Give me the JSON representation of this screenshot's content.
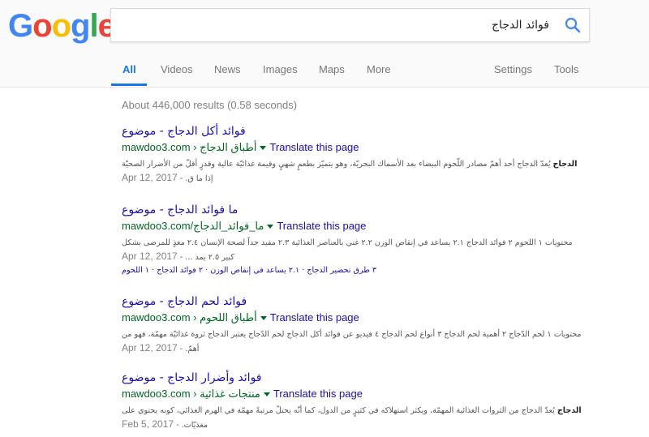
{
  "logo": {
    "letters": [
      "G",
      "o",
      "o",
      "g",
      "l",
      "e"
    ],
    "colors": [
      "#4285F4",
      "#EA4335",
      "#FBBC05",
      "#4285F4",
      "#34A853",
      "#EA4335"
    ]
  },
  "search": {
    "value": "فوائد الدجاج"
  },
  "tabs": [
    {
      "label": "All",
      "active": true
    },
    {
      "label": "Videos"
    },
    {
      "label": "News"
    },
    {
      "label": "Images"
    },
    {
      "label": "Maps"
    },
    {
      "label": "More"
    }
  ],
  "tools": {
    "settings": "Settings",
    "tools": "Tools"
  },
  "stats": "About 446,000 results (0.58 seconds)",
  "translate_label": "Translate this page",
  "results": [
    {
      "title": "فوائد أكل الدجاج - موضوع",
      "url": "mawdoo3.com",
      "path": " › أطباق الدجاج",
      "date": "Apr 12, 2017",
      "snippet_bold": "الدجاج",
      "snippet": " يُعدّ الدجاج أحد أهمّ مصادر اللّحوم البيضاء بعد الأسماك البحريّة، وهو يتميّز بطعمٍ شهيٍ وقيمة غذائيّة عالية وقدرٍ أقلّ من الأضرار الصحيّة إذا ما ق."
    },
    {
      "title": "ما فوائد الدجاج - موضوع",
      "url": "mawdoo3.com/",
      "path": "ما_فوائد_الدجاج",
      "date": "Apr 12, 2017",
      "snippet": "محتويات ١ اللحوم ٢ فوائد الدجاج ٢.١ يساعد في إنقاص الوزن ٢.٢ غني بالعناصر الغذائية ٢.٣ مفيد جداً لصحة الإنسان ٢.٤ مغذٍ للمرضى بشكل كبير ٢.٥ يمد ...",
      "sitelinks": "٣ طرق تحضير الدجاج · ٢.١ يساعد في إنقاص الوزن · ٢ فوائد الدجاج · ١ اللحوم"
    },
    {
      "title": "فوائد لحم الدجاج - موضوع",
      "url": "mawdoo3.com",
      "path": " › أطباق اللحوم",
      "date": "Apr 12, 2017",
      "snippet": "محتويات ١ لحم الدّجاج ٢ أهمية لحم الدجاج ٣ أنواع لحم الدجاج ٤ فيديو عن فوائد أكل الدجاج لحم الدّجاج يعتبر الدجاج ثروة غذائيّة مهمّة، فهو من أهمّ."
    },
    {
      "title": "فوائد وأضرار الدجاج - موضوع",
      "url": "mawdoo3.com",
      "path": " › منتجات غذائية",
      "date": "Feb 5, 2017",
      "snippet_bold": "الدجاج",
      "snippet": " يُعدّ الدجاج من الثروات الغذائية المهمّة، ويكثر استهلاكه في كثيرٍ من الدول، كما أنّه يحتلّ مرتبةً مهمّة في الهرم الغذائي، كونه يحتوي على مغذيّات."
    }
  ]
}
